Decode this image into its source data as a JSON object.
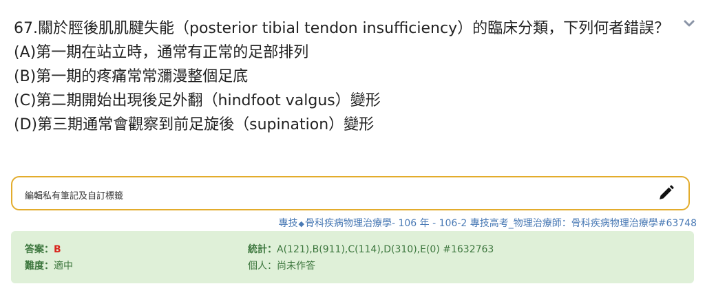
{
  "question": {
    "stem": "67.關於脛後肌肌腱失能（posterior tibial tendon insufficiency）的臨床分類，下列何者錯誤？",
    "options": [
      "(A)第一期在站立時，通常有正常的足部排列",
      "(B)第一期的疼痛常常瀰漫整個足底",
      "(C)第二期開始出現後足外翻（hindfoot valgus）變形",
      "(D)第三期通常會觀察到前足旋後（supination）變形"
    ]
  },
  "note": {
    "label": "編輯私有筆記及自訂標籤"
  },
  "source": {
    "category": "專技",
    "bullet": "◆",
    "text": "骨科疾病物理治療學- 106 年 - 106-2 專技高考_物理治療師：骨科疾病物理治療學#63748"
  },
  "answer_panel": {
    "answer_label": "答案：",
    "answer_value": "B",
    "difficulty_label": "難度：",
    "difficulty_value": "適中",
    "stats_label": "統計：",
    "stats_value": "A(121),B(911),C(114),D(310),E(0) #1632763",
    "personal_label": "個人：",
    "personal_value": "尚未作答"
  },
  "colors": {
    "note_border": "#e3ac2c",
    "answer_panel_bg": "#dff0d8",
    "answer_text": "#3c763d",
    "answer_value": "#d9251d",
    "source_link": "#4a7ab5",
    "toggle_icon": "#8a94a6"
  },
  "icons": {
    "collapse": "chevron-down-icon",
    "edit_note": "pencil-icon"
  }
}
